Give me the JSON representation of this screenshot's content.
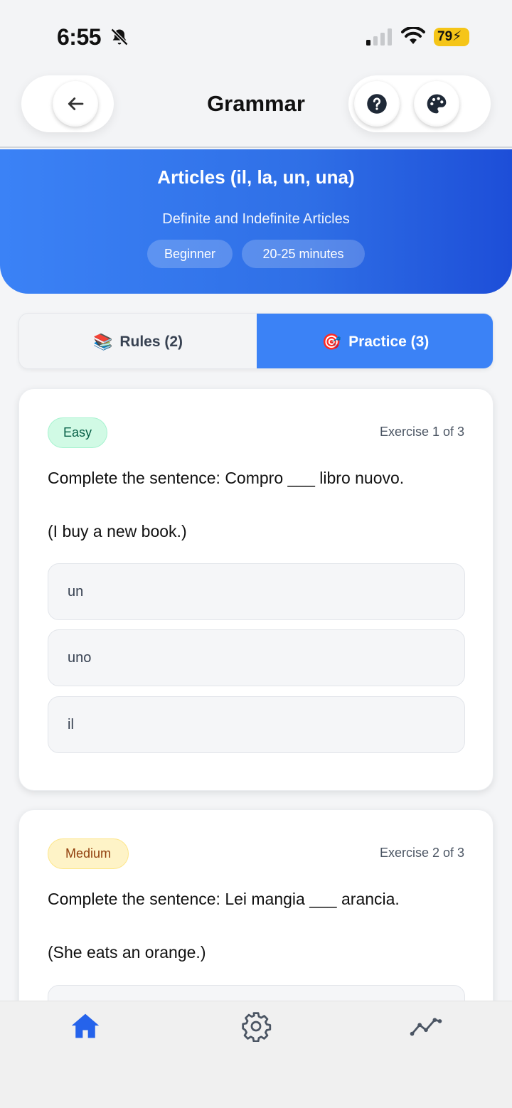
{
  "status_bar": {
    "time": "6:55",
    "battery": "79"
  },
  "header": {
    "title": "Grammar"
  },
  "hero": {
    "title": "Articles (il, la, un, una)",
    "subtitle": "Definite and Indefinite Articles",
    "level": "Beginner",
    "duration": "20-25 minutes"
  },
  "tabs": [
    {
      "icon": "📚",
      "label": "Rules (2)",
      "active": false
    },
    {
      "icon": "🎯",
      "label": "Practice (3)",
      "active": true
    }
  ],
  "exercises": [
    {
      "difficulty": "Easy",
      "counter": "Exercise 1 of 3",
      "question": "Complete the sentence: Compro ___ libro nuovo.",
      "translation": "(I buy a new book.)",
      "options": [
        "un",
        "uno",
        "il"
      ]
    },
    {
      "difficulty": "Medium",
      "counter": "Exercise 2 of 3",
      "question": "Complete the sentence: Lei mangia ___ arancia.",
      "translation": "(She eats an orange.)",
      "options": []
    }
  ],
  "nav": {
    "items": [
      "home-icon",
      "gear-icon",
      "chart-line-icon"
    ]
  },
  "colors": {
    "accent": "#3b82f6",
    "easy": "#d1fae5",
    "medium": "#fef3c7"
  }
}
